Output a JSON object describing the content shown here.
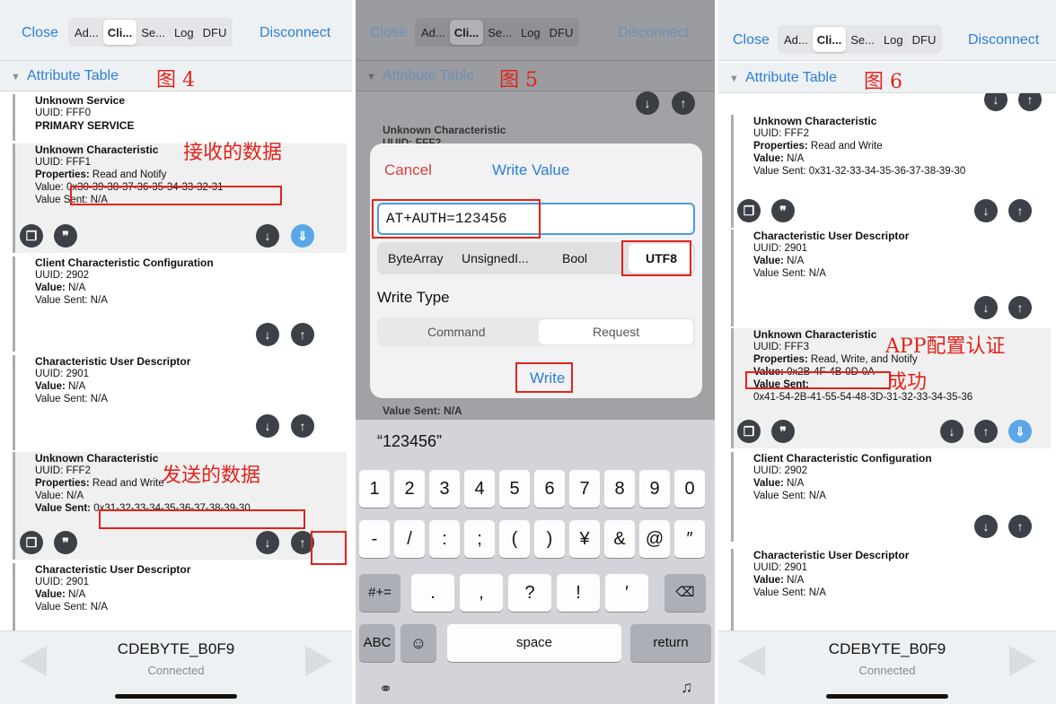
{
  "panels": [
    {
      "topbar": {
        "close": "Close",
        "tabs": [
          "Ad...",
          "Cli...",
          "Se...",
          "Log",
          "DFU"
        ],
        "active": 1,
        "disconnect": "Disconnect"
      },
      "attr_table": "Attribute Table",
      "figure": "图 4",
      "entries": {
        "svc": {
          "title": "Unknown Service",
          "uuid": "UUID: FFF0",
          "kind": "PRIMARY SERVICE"
        },
        "c1": {
          "title": "Unknown Characteristic",
          "uuid": "UUID: FFF1",
          "props_label": "Properties:",
          "props": " Read and Notify",
          "value_label": "Value:",
          "value": " 0x30-39-38-37-36-35-34-33-32-31",
          "sent": "Value Sent: N/A"
        },
        "d1": {
          "title": "Client Characteristic Configuration",
          "uuid": "UUID: 2902",
          "value_label": "Value:",
          "value": " N/A",
          "sent": "Value Sent: N/A"
        },
        "d2": {
          "title": "Characteristic User Descriptor",
          "uuid": "UUID: 2901",
          "value_label": "Value:",
          "value": " N/A",
          "sent": "Value Sent: N/A"
        },
        "c2": {
          "title": "Unknown Characteristic",
          "uuid": "UUID: FFF2",
          "props_label": "Properties:",
          "props": " Read and Write",
          "value": "Value: N/A",
          "sent_label": "Value Sent:",
          "sent": " 0x31-32-33-34-35-36-37-38-39-30"
        },
        "d3": {
          "title": "Characteristic User Descriptor",
          "uuid": "UUID: 2901",
          "value_label": "Value:",
          "value": " N/A",
          "sent": "Value Sent: N/A"
        }
      },
      "notes": {
        "recv": "接收的数据",
        "send": "发送的数据"
      },
      "bottom": {
        "device": "CDEBYTE_B0F9",
        "status": "Connected"
      }
    },
    {
      "topbar": {
        "close": "Close",
        "tabs": [
          "Ad...",
          "Cli...",
          "Se...",
          "Log",
          "DFU"
        ],
        "active": 1,
        "disconnect": "Disconnect"
      },
      "attr_table": "Attribute Table",
      "figure": "图 5",
      "bg_entry": {
        "title": "Unknown Characteristic",
        "uuid": "UUID: FFF2",
        "sent": "Value Sent: N/A"
      },
      "dialog": {
        "cancel": "Cancel",
        "title": "Write Value",
        "input_value": "AT+AUTH=123456",
        "types": [
          "ByteArray",
          "UnsignedI...",
          "Bool",
          "UTF8"
        ],
        "write_type_label": "Write Type",
        "modes": [
          "Command",
          "Request"
        ],
        "write": "Write"
      },
      "keyboard": {
        "suggestion": "“123456”",
        "row1": [
          "1",
          "2",
          "3",
          "4",
          "5",
          "6",
          "7",
          "8",
          "9",
          "0"
        ],
        "row2": [
          "-",
          "/",
          ":",
          ";",
          "(",
          ")",
          "¥",
          "&",
          "@",
          "″"
        ],
        "row3": [
          ".",
          ",",
          "?",
          "!",
          "′"
        ],
        "sym": "#+=",
        "abc": "ABC",
        "space": "space",
        "ret": "return"
      }
    },
    {
      "topbar": {
        "close": "Close",
        "tabs": [
          "Ad...",
          "Cli...",
          "Se...",
          "Log",
          "DFU"
        ],
        "active": 1,
        "disconnect": "Disconnect"
      },
      "attr_table": "Attribute Table",
      "figure": "图 6",
      "entries": {
        "c2": {
          "title": "Unknown Characteristic",
          "uuid": "UUID: FFF2",
          "props_label": "Properties:",
          "props": " Read and Write",
          "value_label": "Value:",
          "value": " N/A",
          "sent": "Value Sent: 0x31-32-33-34-35-36-37-38-39-30"
        },
        "d1": {
          "title": "Characteristic User Descriptor",
          "uuid": "UUID: 2901",
          "value_label": "Value:",
          "value": " N/A",
          "sent": "Value Sent: N/A"
        },
        "c3": {
          "title": "Unknown Characteristic",
          "uuid": "UUID: FFF3",
          "props_label": "Properties:",
          "props": " Read, Write, and Notify",
          "value_label": "Value:",
          "value": " 0x2B-4F-4B-0D-0A",
          "sent_label": "Value Sent:",
          "sent": "0x41-54-2B-41-55-54-48-3D-31-32-33-34-35-36"
        },
        "d2": {
          "title": "Client Characteristic Configuration",
          "uuid": "UUID: 2902",
          "value_label": "Value:",
          "value": " N/A",
          "sent": "Value Sent: N/A"
        },
        "d3": {
          "title": "Characteristic User Descriptor",
          "uuid": "UUID: 2901",
          "value_label": "Value:",
          "value": " N/A",
          "sent": "Value Sent: N/A"
        }
      },
      "notes": {
        "cfg": "APP配置认证",
        "ok": "成功"
      },
      "bottom": {
        "device": "CDEBYTE_B0F9",
        "status": "Connected"
      }
    }
  ],
  "colors": {
    "accent": "#2d7fd3",
    "annotation": "#e2231a",
    "button": "#3c4148"
  },
  "icons": {
    "copy": "copy-icon",
    "quote": "quote-icon",
    "read": "arrow-down-icon",
    "write": "arrow-up-icon",
    "notify": "notify-icon"
  }
}
